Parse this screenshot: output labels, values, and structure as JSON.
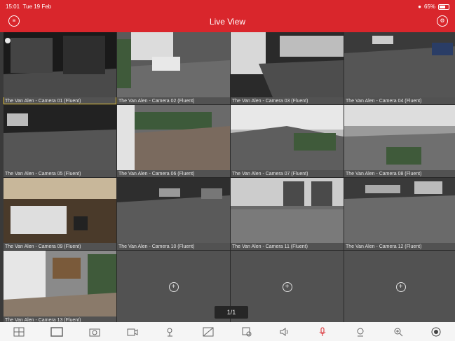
{
  "status": {
    "time": "15:01",
    "date": "Tue 19 Feb",
    "battery": "65%"
  },
  "header": {
    "title": "Live View"
  },
  "cameras": [
    "The Van Alen - Camera 01 (Fluent)",
    "The Van Alen - Camera 02 (Fluent)",
    "The Van Alen - Camera 03 (Fluent)",
    "The Van Alen - Camera 04 (Fluent)",
    "The Van Alen - Camera 05 (Fluent)",
    "The Van Alen - Camera 06 (Fluent)",
    "The Van Alen - Camera 07 (Fluent)",
    "The Van Alen - Camera 08 (Fluent)",
    "The Van Alen - Camera 09 (Fluent)",
    "The Van Alen - Camera 10 (Fluent)",
    "The Van Alen - Camera 11 (Fluent)",
    "The Van Alen - Camera 12 (Fluent)",
    "The Van Alen - Camera 13 (Fluent)"
  ],
  "pager": "1/1",
  "toolbar": [
    "layout-icon",
    "window-icon",
    "snapshot-icon",
    "record-icon",
    "ptz-icon",
    "quality-icon",
    "playback-icon",
    "audio-icon",
    "talk-icon",
    "fisheye-icon",
    "zoom-icon",
    "capture-icon"
  ]
}
